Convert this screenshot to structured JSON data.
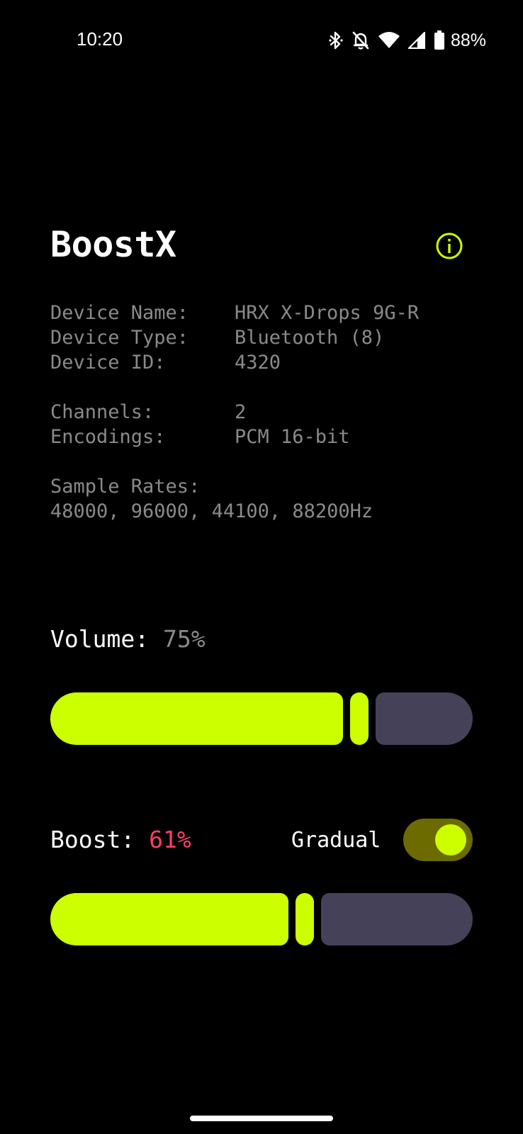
{
  "status_bar": {
    "time": "10:20",
    "battery": "88%",
    "icons": [
      "bluetooth-icon",
      "notifications-off-icon",
      "wifi-icon",
      "cellular-signal-icon",
      "battery-icon"
    ]
  },
  "app": {
    "title": "BoostX",
    "info_icon": "info-icon",
    "accent_color": "#ccff00"
  },
  "device": {
    "name_label": "Device Name:",
    "name_value": "HRX X-Drops 9G-R",
    "type_label": "Device Type:",
    "type_value": "Bluetooth (8)",
    "id_label": "Device ID:",
    "id_value": "4320",
    "channels_label": "Channels:",
    "channels_value": "2",
    "encodings_label": "Encodings:",
    "encodings_value": "PCM 16-bit",
    "sample_rates_label": "Sample Rates:",
    "sample_rates_value": "48000, 96000, 44100, 88200Hz"
  },
  "volume": {
    "label": "Volume: ",
    "percent_text": "75%",
    "level": 0.75
  },
  "boost": {
    "label": "Boost: ",
    "percent_text": "61%",
    "percent_color": "#ff3d6a",
    "level": 0.61,
    "gradual_label": "Gradual",
    "gradual_on": true
  }
}
